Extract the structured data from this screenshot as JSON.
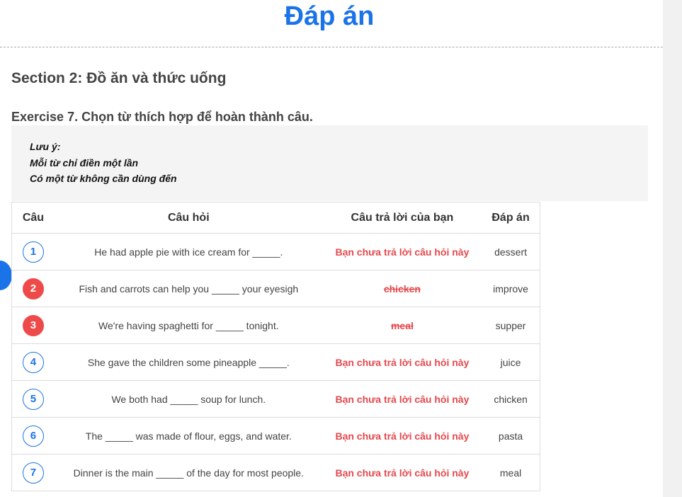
{
  "page": {
    "title": "Đáp án"
  },
  "section": {
    "title": "Section 2: Đồ ăn và thức uống"
  },
  "exercise": {
    "title": "Exercise 7. Chọn từ thích hợp để hoàn thành câu."
  },
  "note": {
    "heading": "Lưu ý:",
    "lines": [
      "Mỗi từ chỉ điền một lần",
      "Có một từ không cần dùng đến"
    ]
  },
  "table": {
    "headers": [
      "Câu",
      "Câu hỏi",
      "Câu trả lời của bạn",
      "Đáp án"
    ],
    "rows": [
      {
        "num": "1",
        "question": "He had apple pie with ice cream for _____.",
        "your_answer": "Bạn chưa trả lời câu hỏi này",
        "status": "unanswered",
        "answer": "dessert"
      },
      {
        "num": "2",
        "question": "Fish and carrots can help you _____ your eyesigh",
        "your_answer": "chicken",
        "status": "wrong",
        "answer": "improve"
      },
      {
        "num": "3",
        "question": "We're having spaghetti for _____ tonight.",
        "your_answer": "meal",
        "status": "wrong",
        "answer": "supper"
      },
      {
        "num": "4",
        "question": "She gave the children some pineapple _____.",
        "your_answer": "Bạn chưa trả lời câu hỏi này",
        "status": "unanswered",
        "answer": "juice"
      },
      {
        "num": "5",
        "question": "We both had _____ soup for lunch.",
        "your_answer": "Bạn chưa trả lời câu hỏi này",
        "status": "unanswered",
        "answer": "chicken"
      },
      {
        "num": "6",
        "question": "The _____ was made of flour, eggs, and water.",
        "your_answer": "Bạn chưa trả lời câu hỏi này",
        "status": "unanswered",
        "answer": "pasta"
      },
      {
        "num": "7",
        "question": "Dinner is the main _____ of the day for most people.",
        "your_answer": "Bạn chưa trả lời câu hỏi này",
        "status": "unanswered",
        "answer": "meal"
      }
    ]
  },
  "colors": {
    "accent": "#1a73e8",
    "error": "#e5484d",
    "wrong_badge": "#ef4a4a"
  }
}
